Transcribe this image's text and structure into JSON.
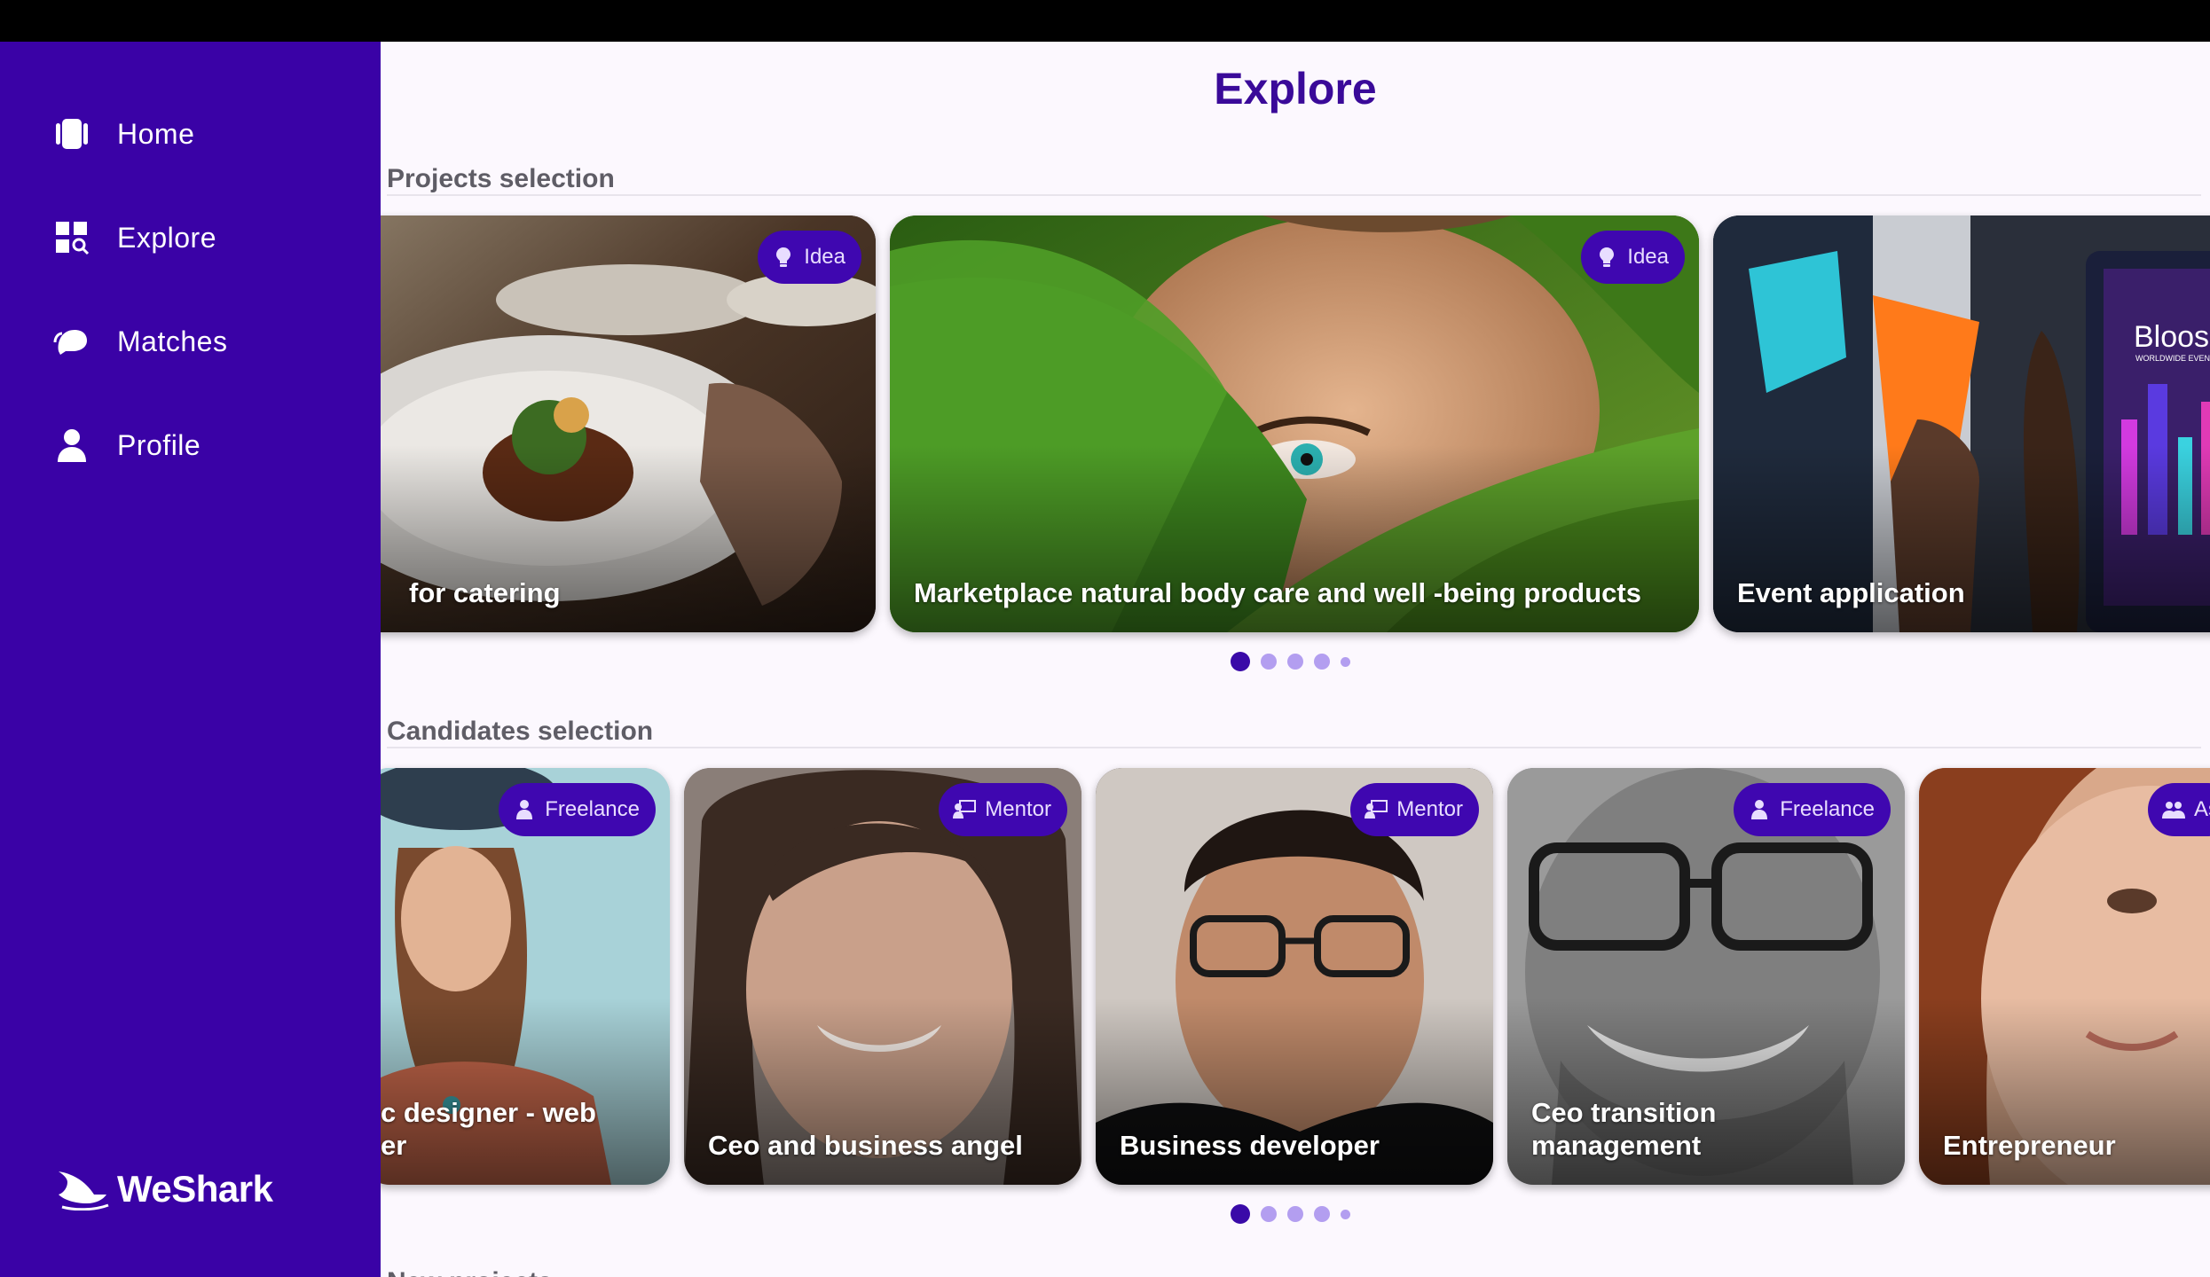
{
  "nav": {
    "items": [
      {
        "label": "Home",
        "icon": "home-icon"
      },
      {
        "label": "Explore",
        "icon": "explore-icon"
      },
      {
        "label": "Matches",
        "icon": "matches-icon"
      },
      {
        "label": "Profile",
        "icon": "profile-icon"
      }
    ],
    "logo": "WeShark"
  },
  "page": {
    "title": "Explore"
  },
  "projects": {
    "title": "Projects selection",
    "cards": [
      {
        "caption": "for catering",
        "badge": "Idea",
        "badge_icon": "lightbulb-icon"
      },
      {
        "caption": "Marketplace natural body care and well -being products",
        "badge": "Idea",
        "badge_icon": "lightbulb-icon"
      },
      {
        "caption": "Event application",
        "badge": "",
        "image_text": "Bloosh",
        "image_subtext": "WORLDWIDE EVENT APP"
      }
    ],
    "pager": {
      "pages": 5,
      "active": 1
    }
  },
  "candidates": {
    "title": "Candidates selection",
    "cards": [
      {
        "caption_lines": [
          "c designer - web",
          "er"
        ],
        "badge": "Freelance",
        "badge_icon": "freelance-icon"
      },
      {
        "caption_lines": [
          "Ceo and business angel"
        ],
        "badge": "Mentor",
        "badge_icon": "mentor-icon"
      },
      {
        "caption_lines": [
          "Business developer"
        ],
        "badge": "Mentor",
        "badge_icon": "mentor-icon"
      },
      {
        "caption_lines": [
          "Ceo transition",
          "management"
        ],
        "badge": "Freelance",
        "badge_icon": "freelance-icon"
      },
      {
        "caption_lines": [
          "Entrepreneur"
        ],
        "badge": "As",
        "badge_icon": "associate-icon"
      }
    ],
    "pager": {
      "pages": 5,
      "active": 1
    }
  },
  "next_section": {
    "title": "New projects"
  },
  "colors": {
    "sidebar": "#3a02a6",
    "accent": "#3a0a99",
    "badge": "#3f07b0",
    "background": "#fcf8fe"
  }
}
